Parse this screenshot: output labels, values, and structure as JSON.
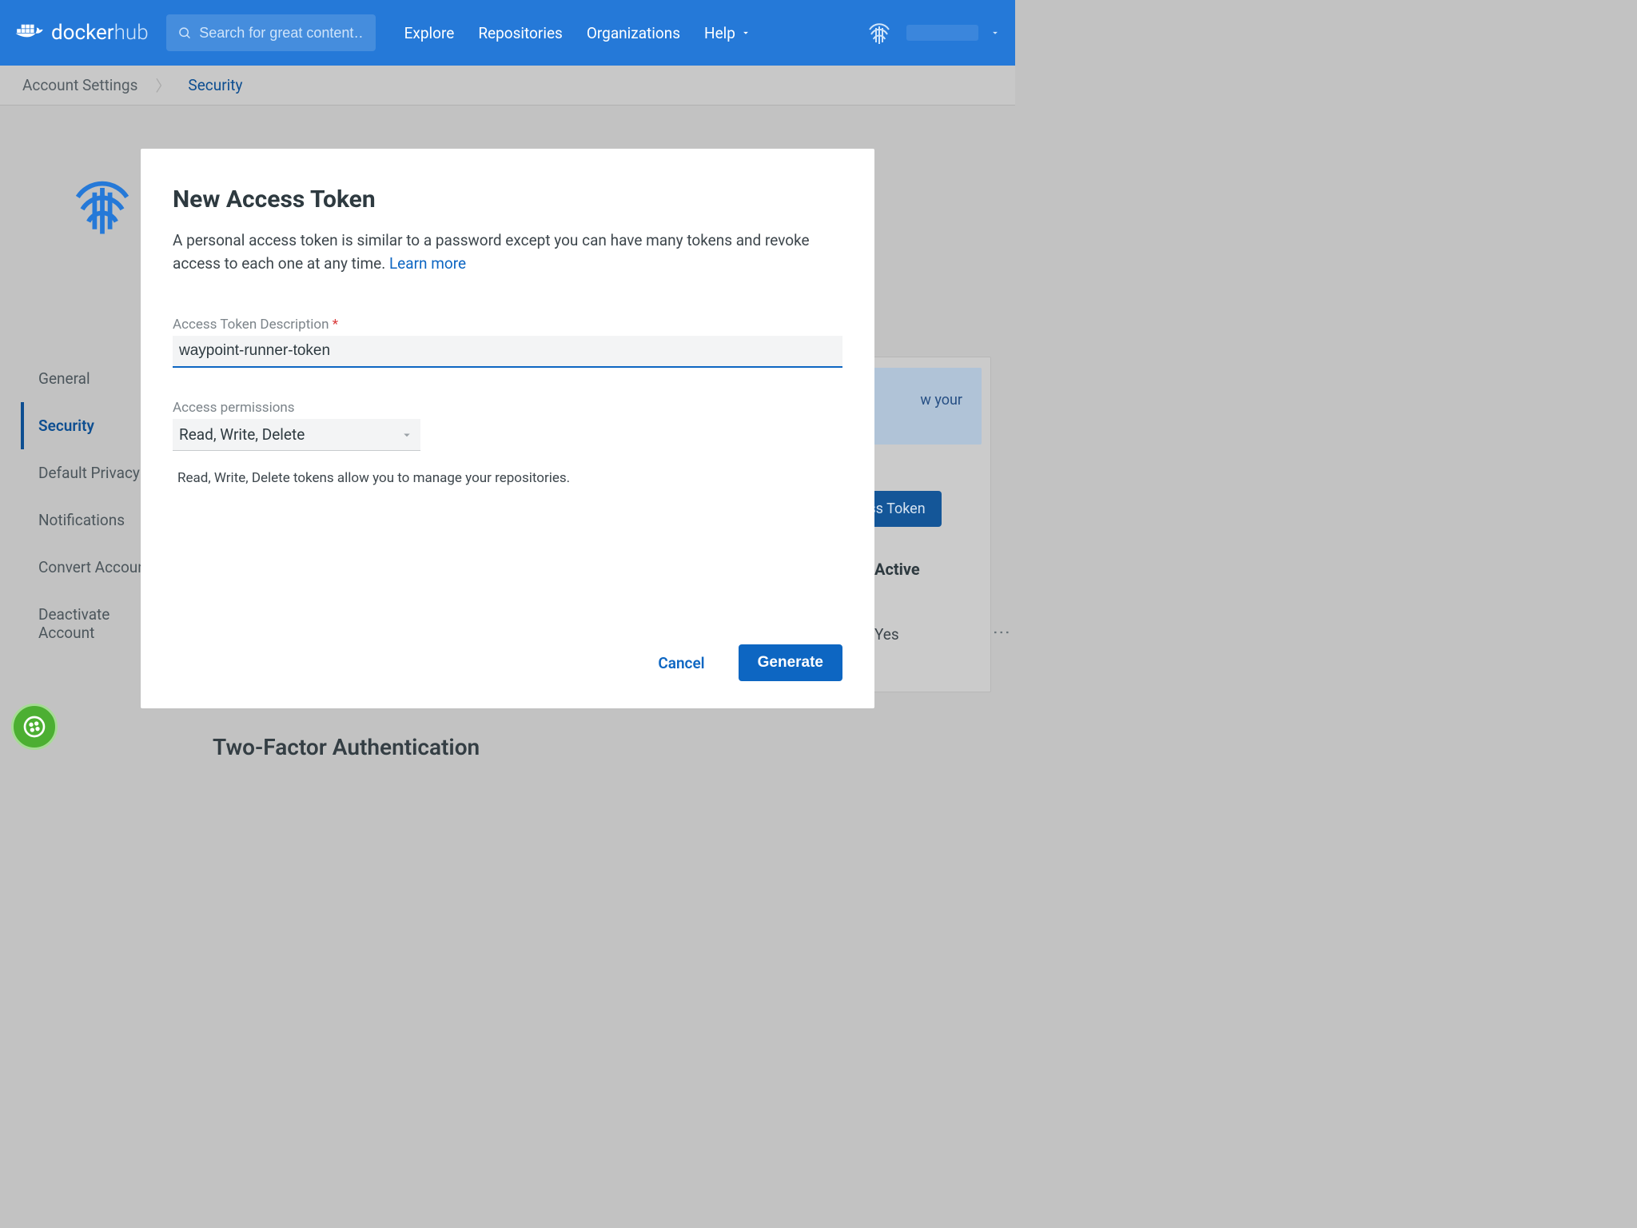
{
  "header": {
    "logo_bold": "docker",
    "logo_light": "hub",
    "search_placeholder": "Search for great content…",
    "nav": {
      "explore": "Explore",
      "repositories": "Repositories",
      "organizations": "Organizations",
      "help": "Help"
    }
  },
  "breadcrumbs": {
    "root": "Account Settings",
    "current": "Security"
  },
  "sidebar": {
    "items": [
      "General",
      "Security",
      "Default Privacy",
      "Notifications",
      "Convert Account",
      "Deactivate Account"
    ],
    "active_index": 1
  },
  "background": {
    "banner_fragment": "w your",
    "button_fragment": "ccess Token",
    "th_active": "Active",
    "td_active": "Yes",
    "two_factor": "Two-Factor Authentication"
  },
  "modal": {
    "title": "New Access Token",
    "description": "A personal access token is similar to a password except you can have many tokens and revoke access to each one at any time. ",
    "learn_more": "Learn more",
    "token_label": "Access Token Description",
    "token_value": "waypoint-runner-token",
    "perms_label": "Access permissions",
    "perms_value": "Read, Write, Delete",
    "perms_helper": "Read, Write, Delete tokens allow you to manage your repositories.",
    "cancel": "Cancel",
    "generate": "Generate"
  }
}
